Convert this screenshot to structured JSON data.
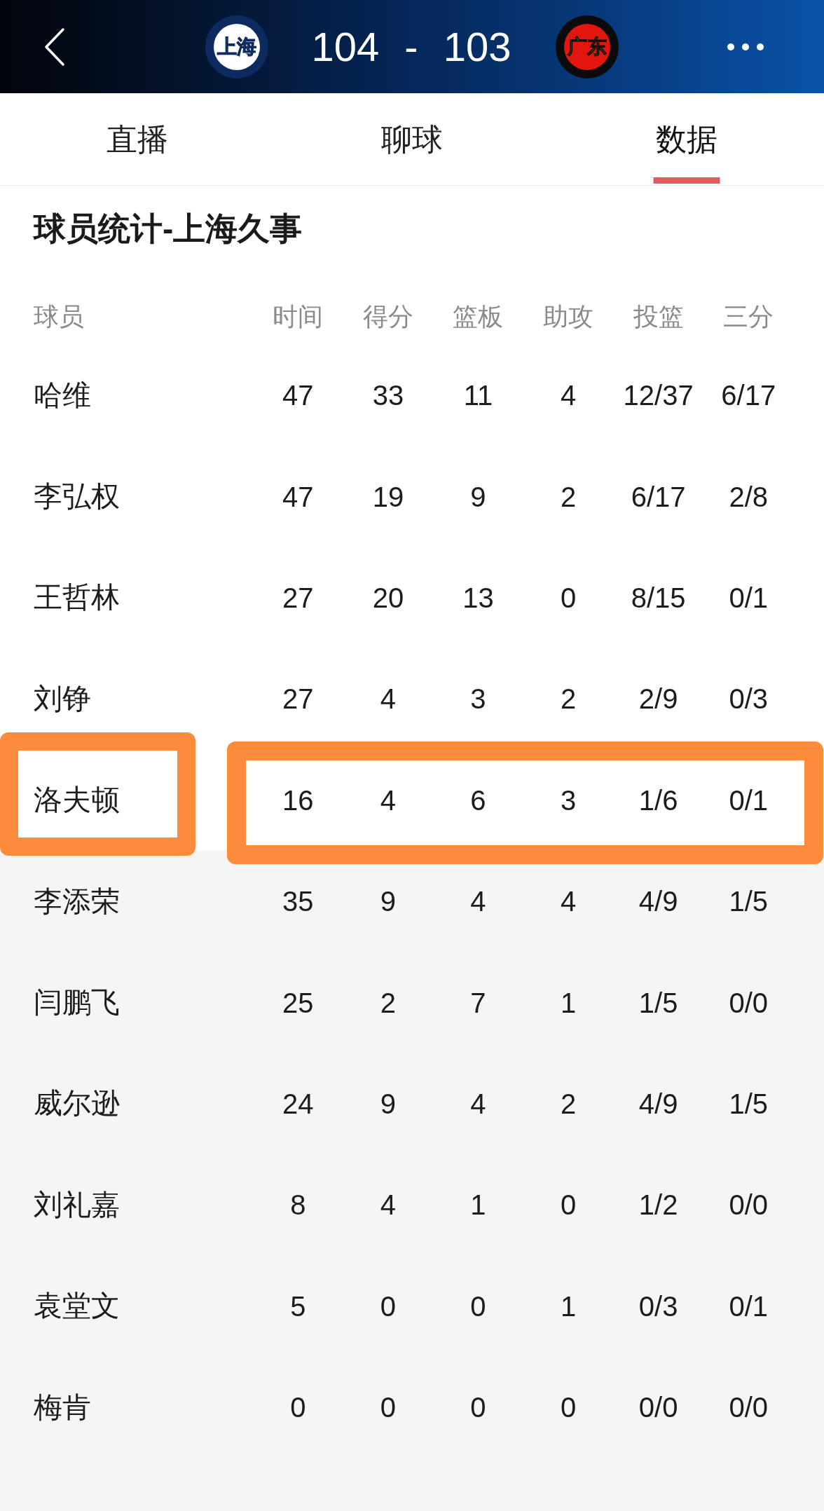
{
  "header": {
    "home": {
      "logo_text": "上海",
      "score": "104"
    },
    "separator": "-",
    "away": {
      "logo_text": "广东",
      "score": "103"
    }
  },
  "tabs": [
    {
      "label": "直播",
      "selected": false
    },
    {
      "label": "聊球",
      "selected": false
    },
    {
      "label": "数据",
      "selected": true
    }
  ],
  "section_title": "球员统计-上海久事",
  "table": {
    "columns": [
      "球员",
      "时间",
      "得分",
      "篮板",
      "助攻",
      "投篮",
      "三分"
    ],
    "starters": [
      {
        "player": "哈维",
        "stats": [
          "47",
          "33",
          "11",
          "4",
          "12/37",
          "6/17"
        ],
        "highlighted": false
      },
      {
        "player": "李弘权",
        "stats": [
          "47",
          "19",
          "9",
          "2",
          "6/17",
          "2/8"
        ],
        "highlighted": false
      },
      {
        "player": "王哲林",
        "stats": [
          "27",
          "20",
          "13",
          "0",
          "8/15",
          "0/1"
        ],
        "highlighted": false
      },
      {
        "player": "刘铮",
        "stats": [
          "27",
          "4",
          "3",
          "2",
          "2/9",
          "0/3"
        ],
        "highlighted": false
      },
      {
        "player": "洛夫顿",
        "stats": [
          "16",
          "4",
          "6",
          "3",
          "1/6",
          "0/1"
        ],
        "highlighted": true
      }
    ],
    "bench": [
      {
        "player": "李添荣",
        "stats": [
          "35",
          "9",
          "4",
          "4",
          "4/9",
          "1/5"
        ],
        "highlighted": false
      },
      {
        "player": "闫鹏飞",
        "stats": [
          "25",
          "2",
          "7",
          "1",
          "1/5",
          "0/0"
        ],
        "highlighted": false
      },
      {
        "player": "威尔逊",
        "stats": [
          "24",
          "9",
          "4",
          "2",
          "4/9",
          "1/5"
        ],
        "highlighted": false
      },
      {
        "player": "刘礼嘉",
        "stats": [
          "8",
          "4",
          "1",
          "0",
          "1/2",
          "0/0"
        ],
        "highlighted": false
      },
      {
        "player": "袁堂文",
        "stats": [
          "5",
          "0",
          "0",
          "1",
          "0/3",
          "0/1"
        ],
        "highlighted": false
      },
      {
        "player": "梅肯",
        "stats": [
          "0",
          "0",
          "0",
          "0",
          "0/0",
          "0/0"
        ],
        "highlighted": false
      }
    ]
  }
}
